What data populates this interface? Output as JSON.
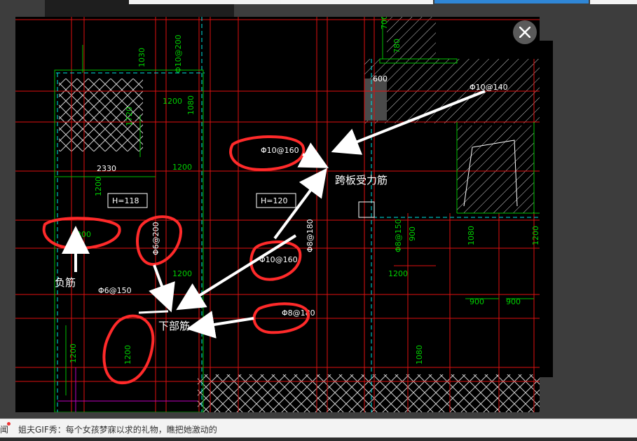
{
  "viewer": {
    "close_icon": "close-icon",
    "drawing": {
      "dimensions_green": [
        "1030",
        "Φ10@200",
        "1080",
        "1720",
        "1200",
        "2330",
        "1200",
        "1200",
        "1200",
        "1200",
        "1200",
        "Φ8@150",
        "900",
        "1080",
        "900",
        "900",
        "1080",
        "1200",
        "700",
        "780"
      ],
      "section_labels": [
        "H=118",
        "H=120"
      ],
      "value_600": "600",
      "rebar_top_right": "Φ10@140",
      "rebar_a": "Φ10@160",
      "rebar_b": "Φ10@160",
      "rebar_c": "Φ8@180",
      "rebar_d": "Φ6@150",
      "rebar_e": "Φ6@200",
      "rebar_f": "Φ8@180",
      "neg_label_num": "1200",
      "bottom_num": "1200"
    },
    "annotations": {
      "span_main": "跨板受力筋",
      "negative": "负筋",
      "bottom": "下部筋"
    }
  },
  "status_bar": {
    "tag": "闻",
    "headline": "姐夫GIF秀：每个女孩梦寐以求的礼物，瞧把她激动的"
  },
  "colors": {
    "highlight_red": "#ff2a2a",
    "cad_green": "#00d000",
    "cad_red": "#e01010",
    "cad_cyan": "#00e5e5"
  }
}
